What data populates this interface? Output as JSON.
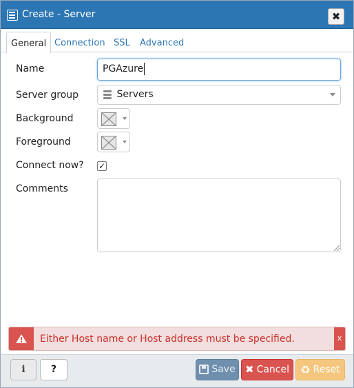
{
  "dialog": {
    "title": "Create - Server",
    "close_label": "✖",
    "title_icon": "server-icon"
  },
  "tabs": [
    {
      "label": "General",
      "active": true
    },
    {
      "label": "Connection",
      "active": false
    },
    {
      "label": "SSL",
      "active": false
    },
    {
      "label": "Advanced",
      "active": false
    }
  ],
  "form": {
    "name": {
      "label": "Name",
      "value": "PGAzure"
    },
    "server_group": {
      "label": "Server group",
      "value": "Servers",
      "icon": "servers-icon"
    },
    "background": {
      "label": "Background",
      "value": "none"
    },
    "foreground": {
      "label": "Foreground",
      "value": "none"
    },
    "connect_now": {
      "label": "Connect now?",
      "checked": true,
      "mark": "✓"
    },
    "comments": {
      "label": "Comments",
      "value": ""
    }
  },
  "alert": {
    "message": "Either Host name or Host address must be specified.",
    "close_label": "x",
    "icon": "warning-icon",
    "color": "#d9534f"
  },
  "footer": {
    "info_label": "i",
    "help_label": "?",
    "save_label": "Save",
    "cancel_label": "Cancel",
    "reset_label": "Reset"
  },
  "colors": {
    "titlebar": "#2c76b4",
    "save": "#6f8fae",
    "cancel": "#d9534f",
    "reset": "#f5c77e"
  }
}
